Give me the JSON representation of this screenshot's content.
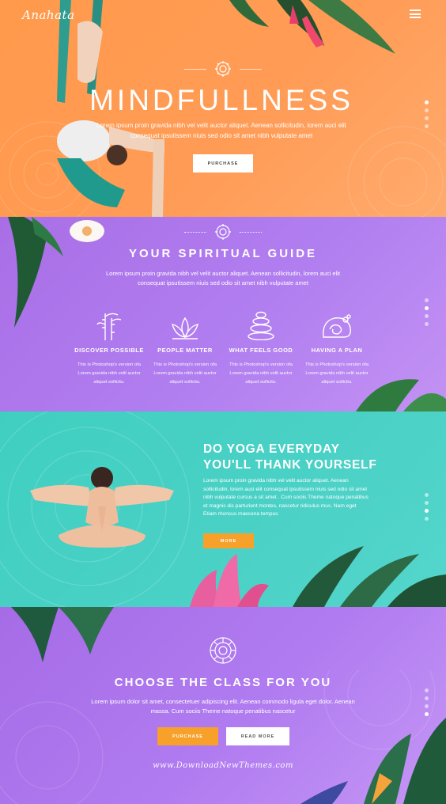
{
  "hero": {
    "logo": "Anahata",
    "menu_icon": "hamburger-icon",
    "title": "MINDFULLNESS",
    "description": "Lorem ipsum proin gravida nibh vel velit auctor aliquet. Aenean sollicitudin, lorem auci elit consequat ipsutissem niuis sed odio sit amet nibh vulputate amet",
    "purchase_label": "PURCHASE"
  },
  "guide": {
    "title": "YOUR SPIRITUAL GUIDE",
    "description": "Lorem ipsum proin gravida nibh vel velit auctor aliquet. Aenean sollicitudin, lorem auci elit consequat ipsutissem niuis sed odio sit amet nibh vulputate amet",
    "features": [
      {
        "icon": "bamboo-icon",
        "name": "DISCOVER POSSIBLE",
        "text": "This is Photoshop's version ofa Lorem gravida nibh velit auctor aliquet sollicitu."
      },
      {
        "icon": "lotus-icon",
        "name": "PEOPLE MATTER",
        "text": "This is Photoshop's version ofa Lorem gravida nibh velit auctor aliquet sollicitu."
      },
      {
        "icon": "stacked-stones-icon",
        "name": "WHAT FEELS GOOD",
        "text": "This is Photoshop's version ofa Lorem gravida nibh velit auctor aliquet sollicitu."
      },
      {
        "icon": "towel-flower-icon",
        "name": "HAVING A PLAN",
        "text": "This is Photoshop's version ofa Lorem gravida nibh velit auctor aliquet sollicitu."
      }
    ]
  },
  "yoga": {
    "title_line1": "DO YOGA EVERYDAY",
    "title_line2": "YOU'LL THANK YOURSELF",
    "description": "Lorem ipsum proin gravida nibh vel velit auctor aliquet. Aenean sollicitudin, lorem auci elit consequat ipsutissem niuis sed odio sit amet nibh vulputate cursus a sit amet . Cum sociis Theme natoque penatibus et magnis dis parturient montes, nascetur ridiculus mus. Nam eget Etiam rhoncus maecena tempus",
    "more_label": "MORE"
  },
  "choose": {
    "title": "CHOOSE THE CLASS FOR YOU",
    "description": "Lorem ipsum dolor sit amet, consectetuer adipiscing elit. Aenean commodo ligula eget dolor. Aenean massa. Cum sociis Theme natoque penatibus nascetur",
    "purchase_label": "PURCHASE",
    "read_more_label": "READ MORE",
    "watermark": "www.DownloadNewThemes.com"
  },
  "colors": {
    "hero_orange": "#ff9a4c",
    "purple": "#b17ef0",
    "teal": "#4bd1c6",
    "accent_orange": "#f7a12b"
  }
}
